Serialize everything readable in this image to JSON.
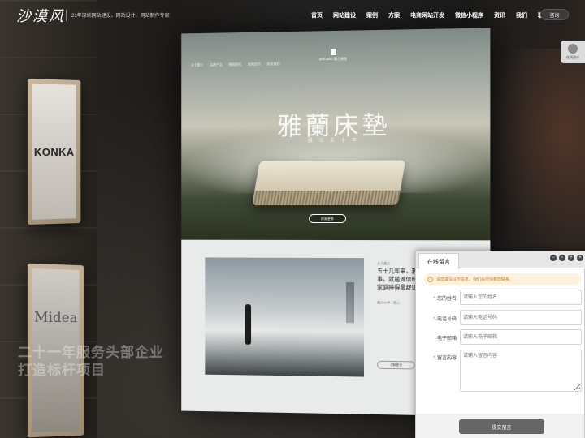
{
  "brand": {
    "logo_text": "沙漠风",
    "tagline": "21年深圳网站建设、网站设计、网站制作专家"
  },
  "nav": {
    "items": [
      "首页",
      "网站建设",
      "案例",
      "方案",
      "电商网站开发",
      "微信小程序",
      "资讯",
      "我们",
      "联系"
    ],
    "consult_label": "咨询"
  },
  "side_widget": {
    "label": "在线咨询"
  },
  "background": {
    "plaque_konka": "KONKA",
    "plaque_midea": "Midea",
    "slogan_line1": "二十一年服务头部企业",
    "slogan_line2": "打造标杆项目"
  },
  "mockup": {
    "nav_items": [
      "关于雅兰",
      "品牌产品",
      "睡眠研究",
      "新闻资讯",
      "联系我们"
    ],
    "logo_text": "AIRLAND 雅兰床垫",
    "hero_title": "雅蘭床墊",
    "hero_sub": "雅 兰 五 十 年",
    "hero_button": "探索更多",
    "section_tag": "关于雅兰",
    "section_heading": "五十几年来，我们一直都在做同一件事，就是诚信经营，用心做床，让中国家庭睡得最舒适的床垫",
    "section_link": "雅兰50年 · 匠心",
    "section_button": "了解更多"
  },
  "message_panel": {
    "tab_label": "在线留言",
    "controls": [
      "minimize",
      "restore",
      "maximize",
      "close"
    ],
    "notice": "请您填写以下信息，我们会尽快和您联系。",
    "fields": [
      {
        "label": "您的姓名",
        "required": true,
        "placeholder": "请输入您的姓名"
      },
      {
        "label": "电话号码",
        "required": true,
        "placeholder": "请输入电话号码"
      },
      {
        "label": "电子邮箱",
        "required": false,
        "placeholder": "请输入电子邮箱"
      },
      {
        "label": "留言内容",
        "required": true,
        "placeholder": "请输入留言内容"
      }
    ],
    "submit_label": "提交留言"
  },
  "colors": {
    "accent": "#e03b3b",
    "notice_text": "#c47a1b",
    "submit_bg": "#666666"
  }
}
